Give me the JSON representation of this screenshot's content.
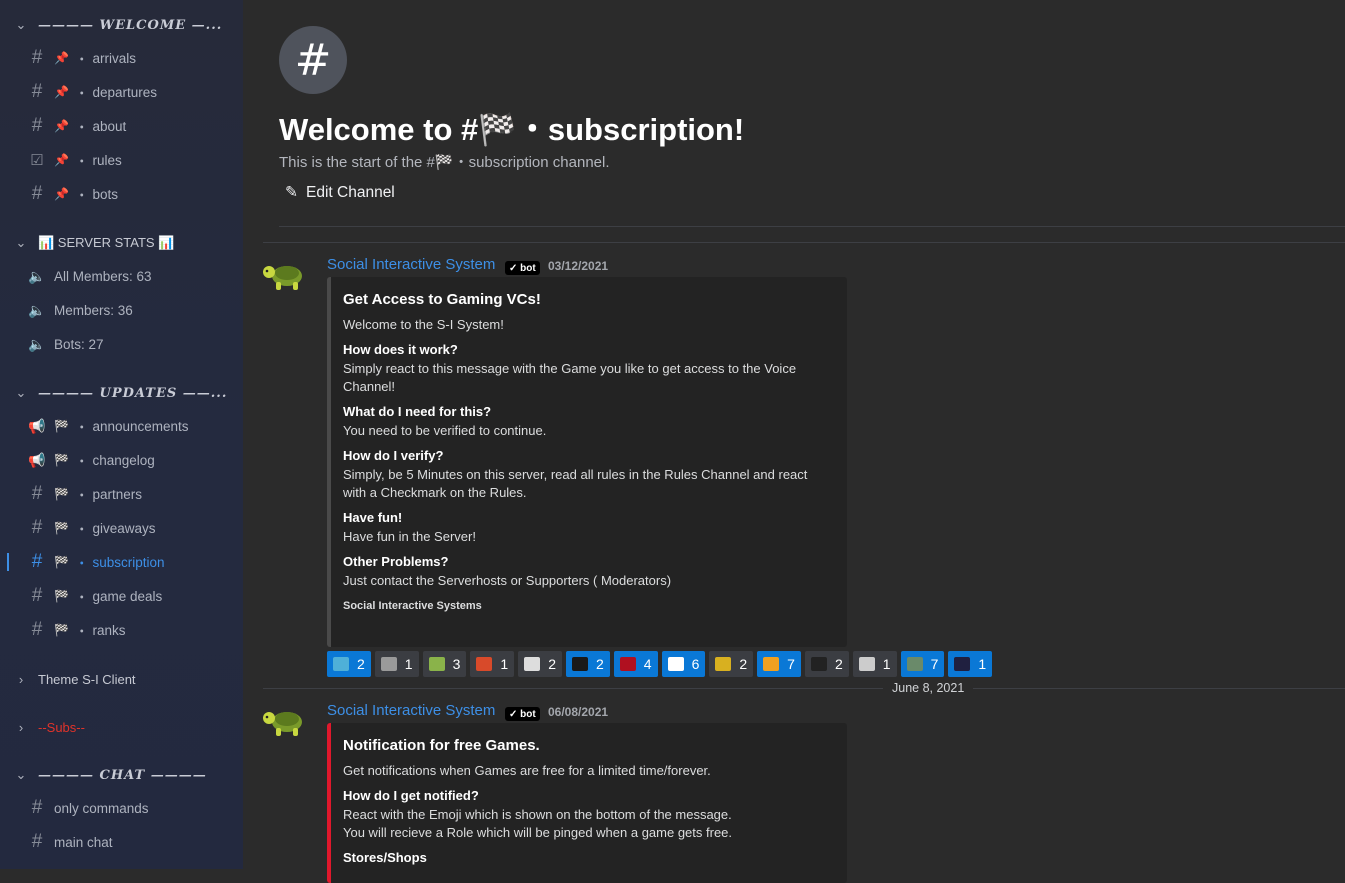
{
  "sidebar": {
    "cat_welcome": "———— WELCOME —...",
    "welcome": [
      {
        "icon": "#",
        "label": "arrivals"
      },
      {
        "icon": "#",
        "label": "departures"
      },
      {
        "icon": "☑",
        "label": "about"
      },
      {
        "icon": "☑",
        "label": "rules"
      },
      {
        "icon": "#",
        "label": "bots"
      }
    ],
    "cat_stats": "📊 SERVER STATS 📊",
    "stats": [
      {
        "label": "All Members: 63"
      },
      {
        "label": "Members: 36"
      },
      {
        "label": "Bots: 27"
      }
    ],
    "cat_updates": "———— UPDATES ——...",
    "updates": [
      {
        "label": "announcements"
      },
      {
        "label": "changelog"
      },
      {
        "label": "partners"
      },
      {
        "label": "giveaways"
      },
      {
        "label": "subscription"
      },
      {
        "label": "game deals"
      },
      {
        "label": "ranks"
      }
    ],
    "cat_theme": "Theme S-I Client",
    "cat_subs": "--Subs--",
    "cat_chat": "———— CHAT ————",
    "chat": [
      {
        "label": "only commands"
      },
      {
        "label": "main chat"
      }
    ],
    "dot": "・"
  },
  "header": {
    "hash": "#",
    "title": "Welcome to #🏁・subscription!",
    "subtitle": "This is the start of the #🏁・subscription channel.",
    "edit_icon": "✎",
    "edit_label": "Edit Channel"
  },
  "messages": [
    {
      "author": "Social Interactive System",
      "bot_tag": "✓ bot",
      "date": "03/12/2021",
      "embed": {
        "title": "Get Access to Gaming VCs!",
        "description": "Welcome to the S-I System!",
        "fields": [
          {
            "name": "How does it work?",
            "value": "Simply react to this message with the Game you like to get access to the Voice Channel!"
          },
          {
            "name": "What do I need for this?",
            "value": "You need to be verified to continue."
          },
          {
            "name": "How do I verify?",
            "value": "Simply, be 5 Minutes on this server, read all rules in the Rules Channel and react with a Checkmark on the Rules."
          },
          {
            "name": "Have fun!",
            "value": "Have fun in the Server!"
          },
          {
            "name": "Other Problems?",
            "value": "Just contact the Serverhosts or Supporters ( Moderators)"
          }
        ],
        "footer": "Social Interactive Systems"
      },
      "reactions": [
        {
          "count": "2",
          "active": true,
          "color": "#4fb0d8"
        },
        {
          "count": "1",
          "active": false,
          "color": "#9a9a9a"
        },
        {
          "count": "3",
          "active": false,
          "color": "#8ab34a"
        },
        {
          "count": "1",
          "active": false,
          "color": "#d84a2a"
        },
        {
          "count": "2",
          "active": false,
          "color": "#dddddd"
        },
        {
          "count": "2",
          "active": true,
          "color": "#1a1a1a"
        },
        {
          "count": "4",
          "active": true,
          "color": "#b01020"
        },
        {
          "count": "6",
          "active": true,
          "color": "#ffffff"
        },
        {
          "count": "2",
          "active": false,
          "color": "#d8b020"
        },
        {
          "count": "7",
          "active": true,
          "color": "#f0a020"
        },
        {
          "count": "2",
          "active": false,
          "color": "#222222"
        },
        {
          "count": "1",
          "active": false,
          "color": "#cccccc"
        },
        {
          "count": "7",
          "active": true,
          "color": "#6a8a6a"
        },
        {
          "count": "1",
          "active": true,
          "color": "#202040"
        }
      ]
    },
    {
      "author": "Social Interactive System",
      "bot_tag": "✓ bot",
      "date": "06/08/2021",
      "embed": {
        "title": "Notification for free Games.",
        "description": "Get notifications when Games are free for a limited time/forever.",
        "fields": [
          {
            "name": "How do I get notified?",
            "value": "React with the Emoji which is shown on the bottom of the message.\nYou will recieve a Role which will be pinged when a game gets free."
          },
          {
            "name": "Stores/Shops",
            "value": ""
          }
        ]
      }
    }
  ],
  "date_separator": "June 8, 2021",
  "colors": {
    "accent": "#3d8fe6",
    "embed_red": "#e0182c",
    "active_reaction": "#0a78d6"
  }
}
